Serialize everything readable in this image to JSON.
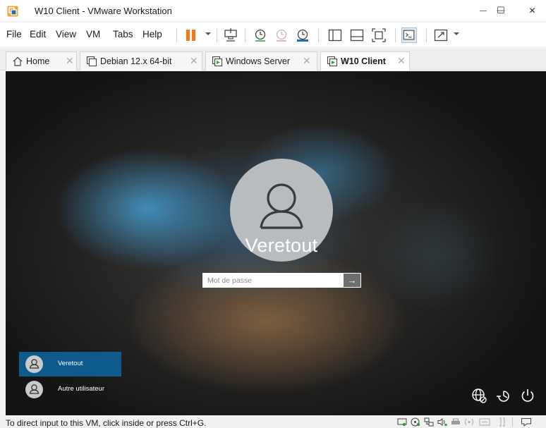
{
  "window": {
    "title": "W10 Client - VMware Workstation",
    "minimize_glyph": "—",
    "maximize_glyph": "☐",
    "close_glyph": "✕"
  },
  "menu": {
    "items": [
      "File",
      "Edit",
      "View",
      "VM",
      "Tabs",
      "Help"
    ]
  },
  "toolbar": {
    "icons": [
      "pause-icon",
      "send-ctrl-alt-del-icon",
      "take-snapshot-icon",
      "revert-snapshot-icon",
      "snapshot-manager-icon",
      "show-library-icon",
      "thumbnail-bar-icon",
      "fit-guest-icon",
      "console-view-icon",
      "fullscreen-icon"
    ],
    "accent_pause": "#f07a1f"
  },
  "tabs": [
    {
      "label": "Home",
      "icon": "home-icon",
      "active": false
    },
    {
      "label": "Debian 12.x 64-bit",
      "icon": "vm-stopped-icon",
      "active": false
    },
    {
      "label": "Windows Server",
      "icon": "vm-running-icon",
      "active": false
    },
    {
      "label": "W10 Client",
      "icon": "vm-running-icon",
      "active": true
    }
  ],
  "tab_close_glyph": "✕",
  "vm": {
    "username": "Veretout",
    "password_placeholder": "Mot de passe",
    "submit_glyph": "→",
    "users": [
      {
        "label": "Veretout",
        "selected": true
      },
      {
        "label": "Autre utilisateur",
        "selected": false
      }
    ],
    "system_icons": [
      "network-icon",
      "ease-of-access-icon",
      "power-icon"
    ],
    "selected_tile_color": "#0f5a8c"
  },
  "status": {
    "text": "To direct input to this VM, click inside or press Ctrl+G.",
    "icons": [
      "hard-disk-icon",
      "cd-dvd-icon",
      "network-adapter-icon",
      "sound-icon",
      "printer-icon",
      "usb-icon",
      "display-icon",
      "stretch-icon",
      "message-icon"
    ]
  }
}
